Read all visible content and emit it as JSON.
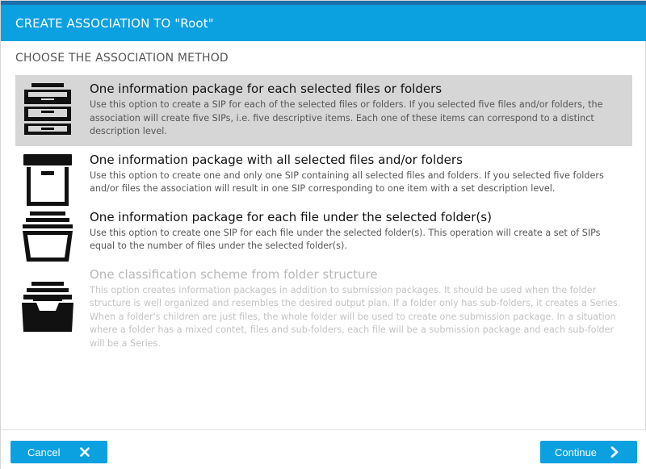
{
  "dialog": {
    "title": "CREATE ASSOCIATION TO \"Root\"",
    "section_title": "CHOOSE THE ASSOCIATION METHOD"
  },
  "options": [
    {
      "icon": "filing-cabinet-drawers-icon",
      "title": "One information package for each selected files or folders",
      "description": "Use this option to create a SIP for each of the selected files or folders. If you selected five files and/or folders, the association will create five SIPs, i.e. five descriptive items. Each one of these items can correspond to a distinct description level.",
      "selected": true,
      "enabled": true
    },
    {
      "icon": "archive-box-icon",
      "title": "One information package with all selected files and/or folders",
      "description": "Use this option to create one and only one SIP containing all selected files and folders. If you selected five folders and/or files the association will result in one SIP corresponding to one item with a set description level.",
      "selected": false,
      "enabled": true
    },
    {
      "icon": "stacked-trays-icon",
      "title": "One information package for each file under the selected folder(s)",
      "description": "Use this option to create one SIP for each file under the selected folder(s). This operation will create a set of SIPs equal to the number of files under the selected folder(s).",
      "selected": false,
      "enabled": true
    },
    {
      "icon": "inbox-tray-icon",
      "title": "One classification scheme from folder structure",
      "description": "This option creates information packages in addition to submission packages. It should be used when the folder structure is well organized and resembles the desired output plan. If a folder only has sub-folders, it creates a Series. When a folder's children are just files, the whole folder will be used to create one submission package. In a situation where a folder has a mixed contet, files and sub-folders, each file will be a submission package and each sub-folder will be a Series.",
      "selected": false,
      "enabled": false
    }
  ],
  "footer": {
    "cancel_label": "Cancel",
    "cancel_icon": "close-icon",
    "continue_label": "Continue",
    "continue_icon": "chevron-right-icon"
  },
  "colors": {
    "header_bg": "#0ba0e0",
    "top_strip": "#1c6fa8",
    "selected_bg": "#d6d6d6",
    "button_bg": "#0ba0e0"
  }
}
